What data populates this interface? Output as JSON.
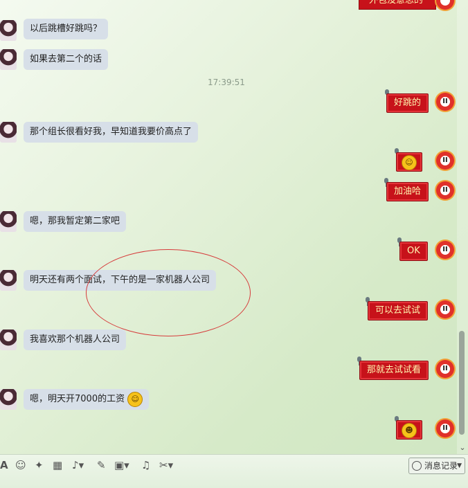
{
  "messages_in": [
    {
      "text": "以后跳槽好跳吗？"
    },
    {
      "text": "如果去第二个的话"
    },
    {
      "text": "那个组长很看好我，早知道我要价高点了"
    },
    {
      "text": "嗯，那我暂定第二家吧"
    },
    {
      "text": "明天还有两个面试，下午的是一家机器人公司"
    },
    {
      "text": "我喜欢那个机器人公司"
    },
    {
      "text": "嗯，明天开7000的工资"
    }
  ],
  "messages_out": [
    {
      "text": "好跳的"
    },
    {
      "text": "",
      "emoji": "grin-emoji"
    },
    {
      "text": "加油哈"
    },
    {
      "text": "OK"
    },
    {
      "text": "可以去试试"
    },
    {
      "text": "那就去试试看"
    },
    {
      "text": "",
      "emoji": "laugh-emoji"
    }
  ],
  "top_cut_text": "外包没意思的",
  "timestamp": "17:39:51",
  "toolbar": {
    "font_label": "A",
    "history_label": "消息记录"
  },
  "colors": {
    "out_bubble": "#c7121a",
    "out_text": "#fff6b0",
    "in_bubble": "#d7dfe8",
    "annotation": "#d63a3a"
  },
  "icons": [
    "font-icon",
    "emoji-icon",
    "magic-icon",
    "shake-icon",
    "voice-icon",
    "edit-icon",
    "image-icon",
    "music-icon",
    "screenshot-icon",
    "clock-icon"
  ]
}
